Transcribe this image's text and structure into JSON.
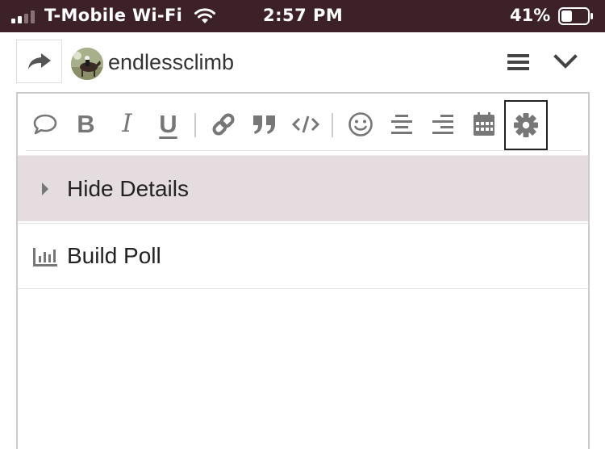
{
  "status_bar": {
    "carrier": "T-Mobile Wi-Fi",
    "time": "2:57 PM",
    "battery_percent": "41%",
    "battery_level": 0.41,
    "signal_bars_active": 2,
    "signal_bars_total": 4
  },
  "header": {
    "username": "endlessclimb",
    "icons": [
      "share-icon",
      "avatar",
      "hamburger-menu-icon",
      "chevron-down-icon"
    ]
  },
  "toolbar": {
    "buttons": [
      {
        "name": "quote-bubble",
        "icon": "speech-bubble-icon"
      },
      {
        "name": "bold",
        "label": "B"
      },
      {
        "name": "italic",
        "label": "I"
      },
      {
        "name": "underline",
        "label": "U"
      },
      {
        "name": "link",
        "icon": "link-icon"
      },
      {
        "name": "blockquote",
        "icon": "quote-icon"
      },
      {
        "name": "code",
        "icon": "code-icon"
      },
      {
        "name": "emoji",
        "icon": "smiley-icon"
      },
      {
        "name": "align-center",
        "icon": "align-center-icon"
      },
      {
        "name": "align-right",
        "icon": "align-right-icon"
      },
      {
        "name": "calendar",
        "icon": "calendar-icon"
      },
      {
        "name": "settings",
        "icon": "gear-icon",
        "active": true
      }
    ]
  },
  "menu": {
    "hide_details": "Hide Details",
    "build_poll": "Build Poll"
  },
  "colors": {
    "status_bar_bg": "#3d2129",
    "highlight_row_bg": "#e5dcdf",
    "icon_gray": "#777777"
  }
}
